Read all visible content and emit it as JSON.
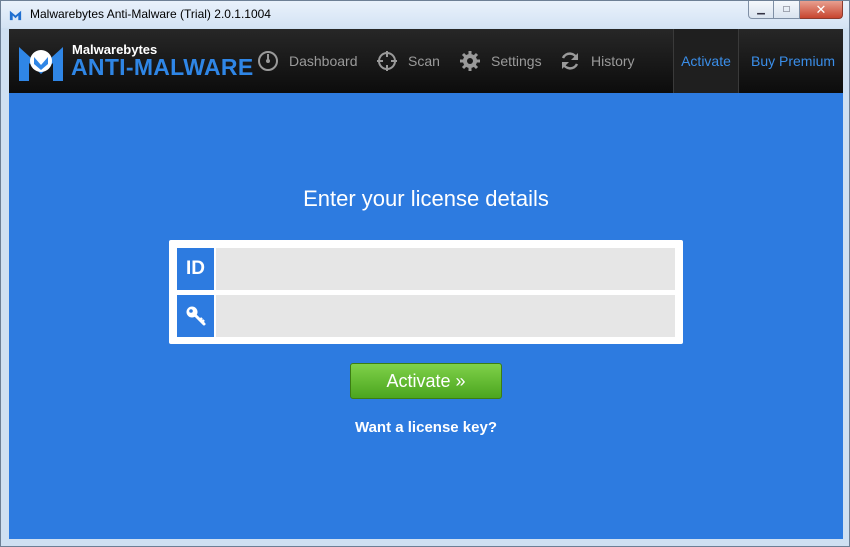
{
  "window": {
    "title": "Malwarebytes Anti-Malware (Trial) 2.0.1.1004",
    "controls": {
      "minimize": "▁",
      "maximize": "□",
      "close": "✕"
    }
  },
  "header": {
    "brand_small": "Malwarebytes",
    "brand_big": "ANTI-MALWARE",
    "nav": [
      {
        "label": "Dashboard",
        "icon": "gauge-icon"
      },
      {
        "label": "Scan",
        "icon": "crosshair-icon"
      },
      {
        "label": "Settings",
        "icon": "gear-icon"
      },
      {
        "label": "History",
        "icon": "refresh-icon"
      }
    ],
    "activate_label": "Activate",
    "premium_label": "Buy Premium"
  },
  "form": {
    "heading": "Enter your license details",
    "id_badge": "ID",
    "id_value": "",
    "key_value": "",
    "activate_button": "Activate »",
    "license_link": "Want a license key?"
  },
  "colors": {
    "content_bg": "#2d7be0",
    "accent_blue": "#2f86e6",
    "button_green": "#5cb82c",
    "header_bg": "#141414"
  }
}
